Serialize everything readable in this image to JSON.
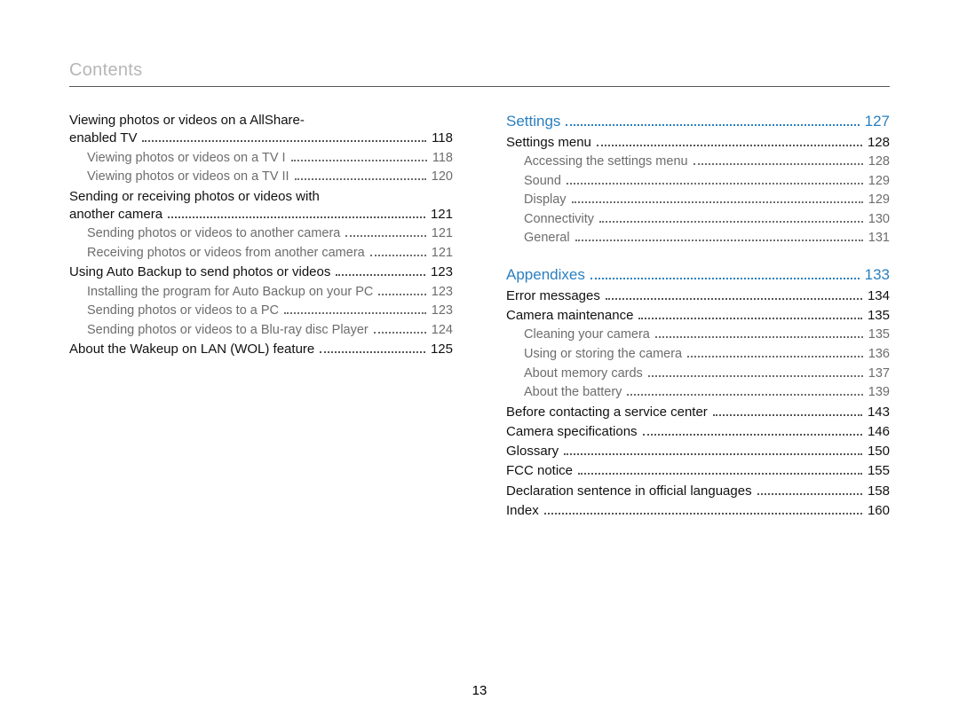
{
  "header": {
    "title": "Contents"
  },
  "page_number": "13",
  "columns": {
    "left": [
      {
        "type": "wrap",
        "text": "Viewing photos or videos on a AllShare-"
      },
      {
        "type": "main",
        "label": "enabled TV",
        "page": "118"
      },
      {
        "type": "sub",
        "label": "Viewing photos or videos on a TV I",
        "page": "118"
      },
      {
        "type": "sub",
        "label": "Viewing photos or videos on a TV II",
        "page": "120"
      },
      {
        "type": "wrap",
        "text": "Sending or receiving photos or videos with"
      },
      {
        "type": "main",
        "label": "another camera",
        "page": "121"
      },
      {
        "type": "sub",
        "label": "Sending photos or videos to another camera",
        "page": "121"
      },
      {
        "type": "sub",
        "label": "Receiving photos or videos from another camera",
        "page": "121"
      },
      {
        "type": "main",
        "label": "Using Auto Backup to send photos or videos",
        "page": "123"
      },
      {
        "type": "sub",
        "label": "Installing the program for Auto Backup on your PC",
        "page": "123"
      },
      {
        "type": "sub",
        "label": "Sending photos or videos to a PC",
        "page": "123"
      },
      {
        "type": "sub",
        "label": "Sending photos or videos to a Blu-ray disc Player",
        "page": "124"
      },
      {
        "type": "main",
        "label": "About the Wakeup on LAN (WOL) feature",
        "page": "125"
      }
    ],
    "right": [
      {
        "type": "section",
        "label": "Settings",
        "page": "127"
      },
      {
        "type": "main",
        "label": "Settings menu",
        "page": "128"
      },
      {
        "type": "sub",
        "label": "Accessing the settings menu",
        "page": "128"
      },
      {
        "type": "sub",
        "label": "Sound",
        "page": "129"
      },
      {
        "type": "sub",
        "label": "Display",
        "page": "129"
      },
      {
        "type": "sub",
        "label": "Connectivity",
        "page": "130"
      },
      {
        "type": "sub",
        "label": "General",
        "page": "131"
      },
      {
        "type": "spacer"
      },
      {
        "type": "section",
        "label": "Appendixes",
        "page": "133"
      },
      {
        "type": "main",
        "label": "Error messages",
        "page": "134"
      },
      {
        "type": "main",
        "label": "Camera maintenance",
        "page": "135"
      },
      {
        "type": "sub",
        "label": "Cleaning your camera",
        "page": "135"
      },
      {
        "type": "sub",
        "label": "Using or storing the camera",
        "page": "136"
      },
      {
        "type": "sub",
        "label": "About memory cards",
        "page": "137"
      },
      {
        "type": "sub",
        "label": "About the battery",
        "page": "139"
      },
      {
        "type": "main",
        "label": "Before contacting a service center",
        "page": "143"
      },
      {
        "type": "main",
        "label": "Camera specifications",
        "page": "146"
      },
      {
        "type": "main",
        "label": "Glossary",
        "page": "150"
      },
      {
        "type": "main",
        "label": "FCC notice",
        "page": "155"
      },
      {
        "type": "main",
        "label": "Declaration sentence in official languages",
        "page": "158"
      },
      {
        "type": "main",
        "label": "Index",
        "page": "160"
      }
    ]
  }
}
